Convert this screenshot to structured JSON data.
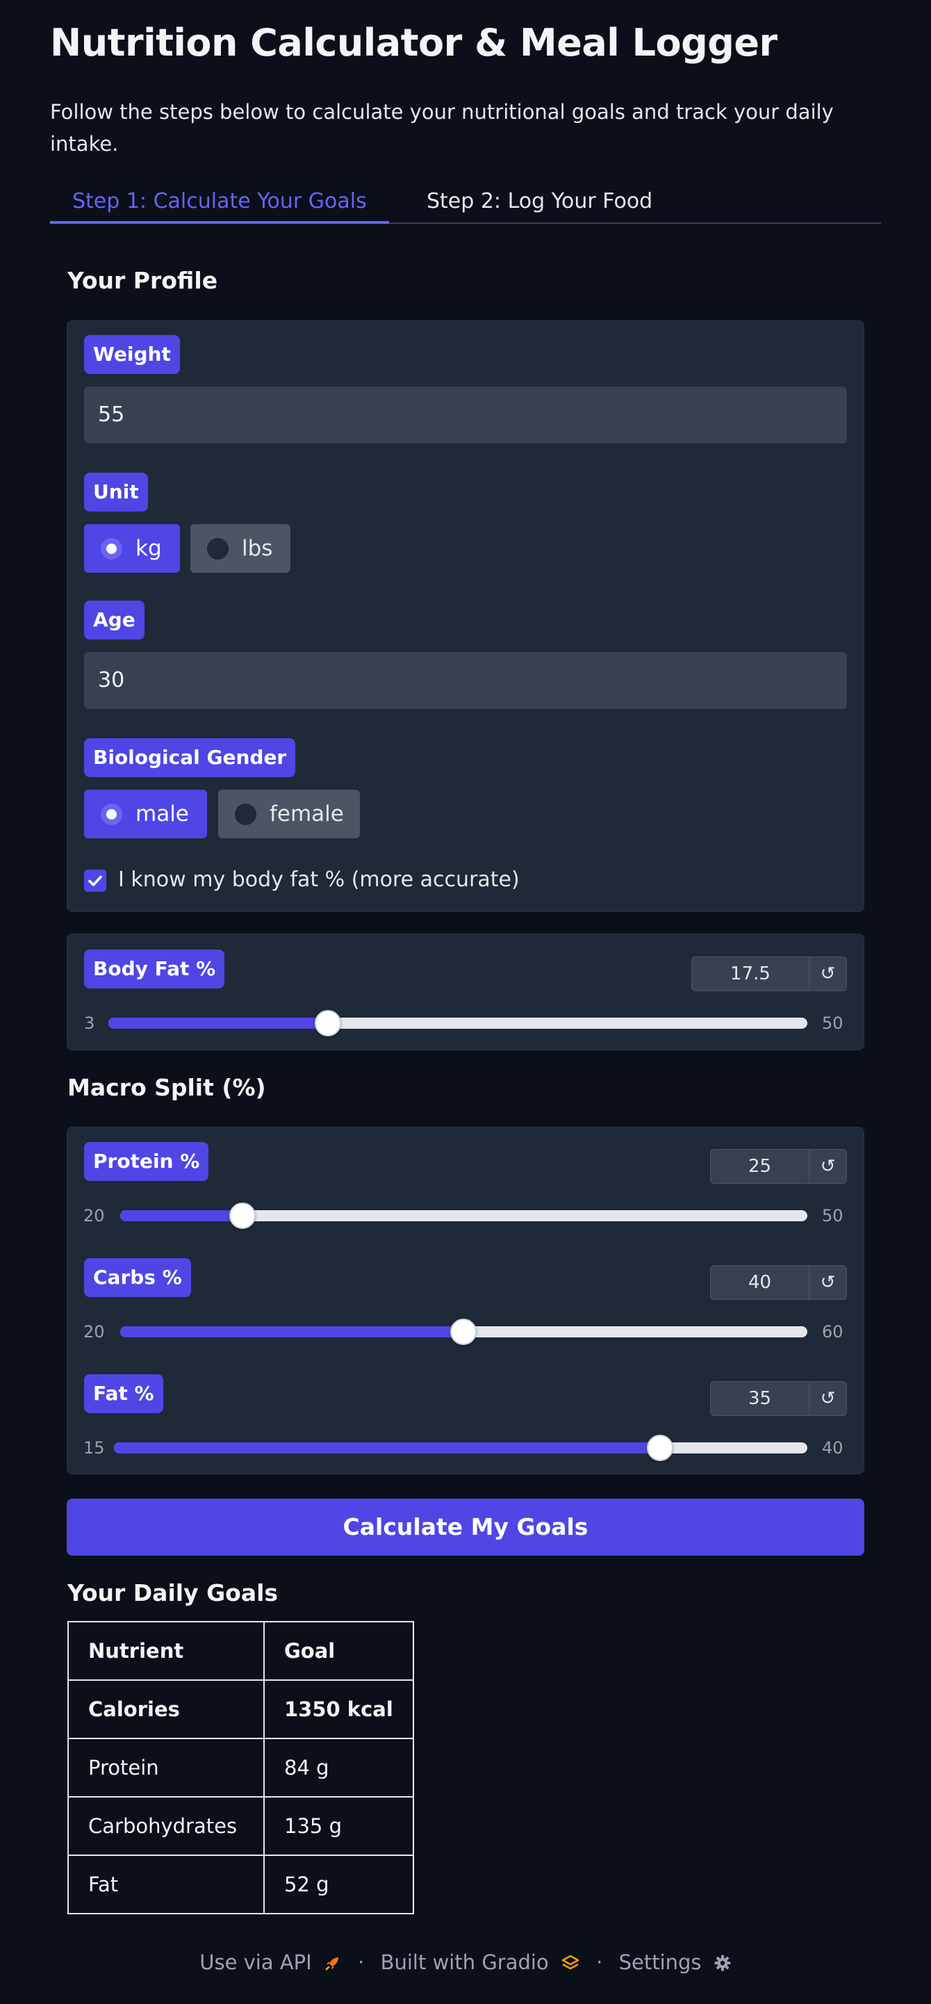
{
  "app": {
    "title": "Nutrition Calculator & Meal Logger",
    "description": "Follow the steps below to calculate your nutritional goals and track your daily intake."
  },
  "tabs": [
    {
      "label": "Step 1: Calculate Your Goals",
      "selected": true
    },
    {
      "label": "Step 2: Log Your Food",
      "selected": false
    }
  ],
  "profile": {
    "title": "Your Profile",
    "weight": {
      "label": "Weight",
      "value": "55"
    },
    "unit": {
      "label": "Unit",
      "options": [
        "kg",
        "lbs"
      ],
      "selected": "kg"
    },
    "age": {
      "label": "Age",
      "value": "30"
    },
    "gender": {
      "label": "Biological Gender",
      "options": [
        "male",
        "female"
      ],
      "selected": "male"
    },
    "bodyfat_checkbox": {
      "label": "I know my body fat % (more accurate)",
      "checked": true
    }
  },
  "bodyfat": {
    "label": "Body Fat %",
    "value": "17.5",
    "min": "3",
    "max": "50"
  },
  "macro": {
    "title": "Macro Split (%)",
    "protein": {
      "label": "Protein %",
      "value": "25",
      "min": "20",
      "max": "50"
    },
    "carbs": {
      "label": "Carbs %",
      "value": "40",
      "min": "20",
      "max": "60"
    },
    "fat": {
      "label": "Fat %",
      "value": "35",
      "min": "15",
      "max": "40"
    }
  },
  "calculate_button": "Calculate My Goals",
  "goals": {
    "title": "Your Daily Goals",
    "headers": [
      "Nutrient",
      "Goal"
    ],
    "rows": [
      [
        "Calories",
        "1350 kcal"
      ],
      [
        "Protein",
        "84 g"
      ],
      [
        "Carbohydrates",
        "135 g"
      ],
      [
        "Fat",
        "52 g"
      ]
    ]
  },
  "footer": {
    "api": "Use via API",
    "built": "Built with Gradio",
    "settings": "Settings",
    "separator": "·"
  },
  "icons": {
    "reset": "reset-icon",
    "check": "check-icon",
    "rocket": "rocket-icon",
    "gradio": "gradio-logo-icon",
    "gear": "gear-icon"
  },
  "colors": {
    "accent": "#4f46e5",
    "background": "#0b0f19",
    "panel": "#1f2937",
    "input": "#374151"
  }
}
